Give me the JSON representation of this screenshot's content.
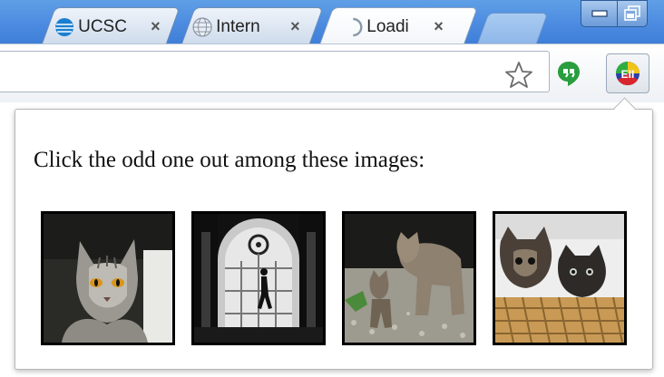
{
  "tabs": [
    {
      "title": "UCSC",
      "favicon": "att-globe-icon",
      "close": "×"
    },
    {
      "title": "Intern",
      "favicon": "globe-icon",
      "close": "×"
    },
    {
      "title": "Loadi",
      "favicon": "loading-spinner-icon",
      "close": "×",
      "active": true
    }
  ],
  "window_controls": {
    "minimize": "minimize-icon",
    "restore": "restore-icon"
  },
  "toolbar": {
    "address_value": "",
    "bookmark_icon": "star-icon",
    "extensions": [
      "hangouts-icon",
      "odd-one-out-extension-icon"
    ]
  },
  "popup": {
    "prompt": "Click the odd one out among these images:",
    "images": [
      {
        "subject": "gray tabby cat with orange eyes",
        "icon": "cat-photo"
      },
      {
        "subject": "silhouette of a person in front of an arched window",
        "icon": "person-photo"
      },
      {
        "subject": "adult cat with kitten on gravel",
        "icon": "cat-photo"
      },
      {
        "subject": "two kittens in a wicker basket",
        "icon": "cat-photo"
      }
    ]
  },
  "colors": {
    "tabstrip": "#4c8be0",
    "popup_border": "#b8b8b8",
    "thumb_border": "#000000"
  }
}
